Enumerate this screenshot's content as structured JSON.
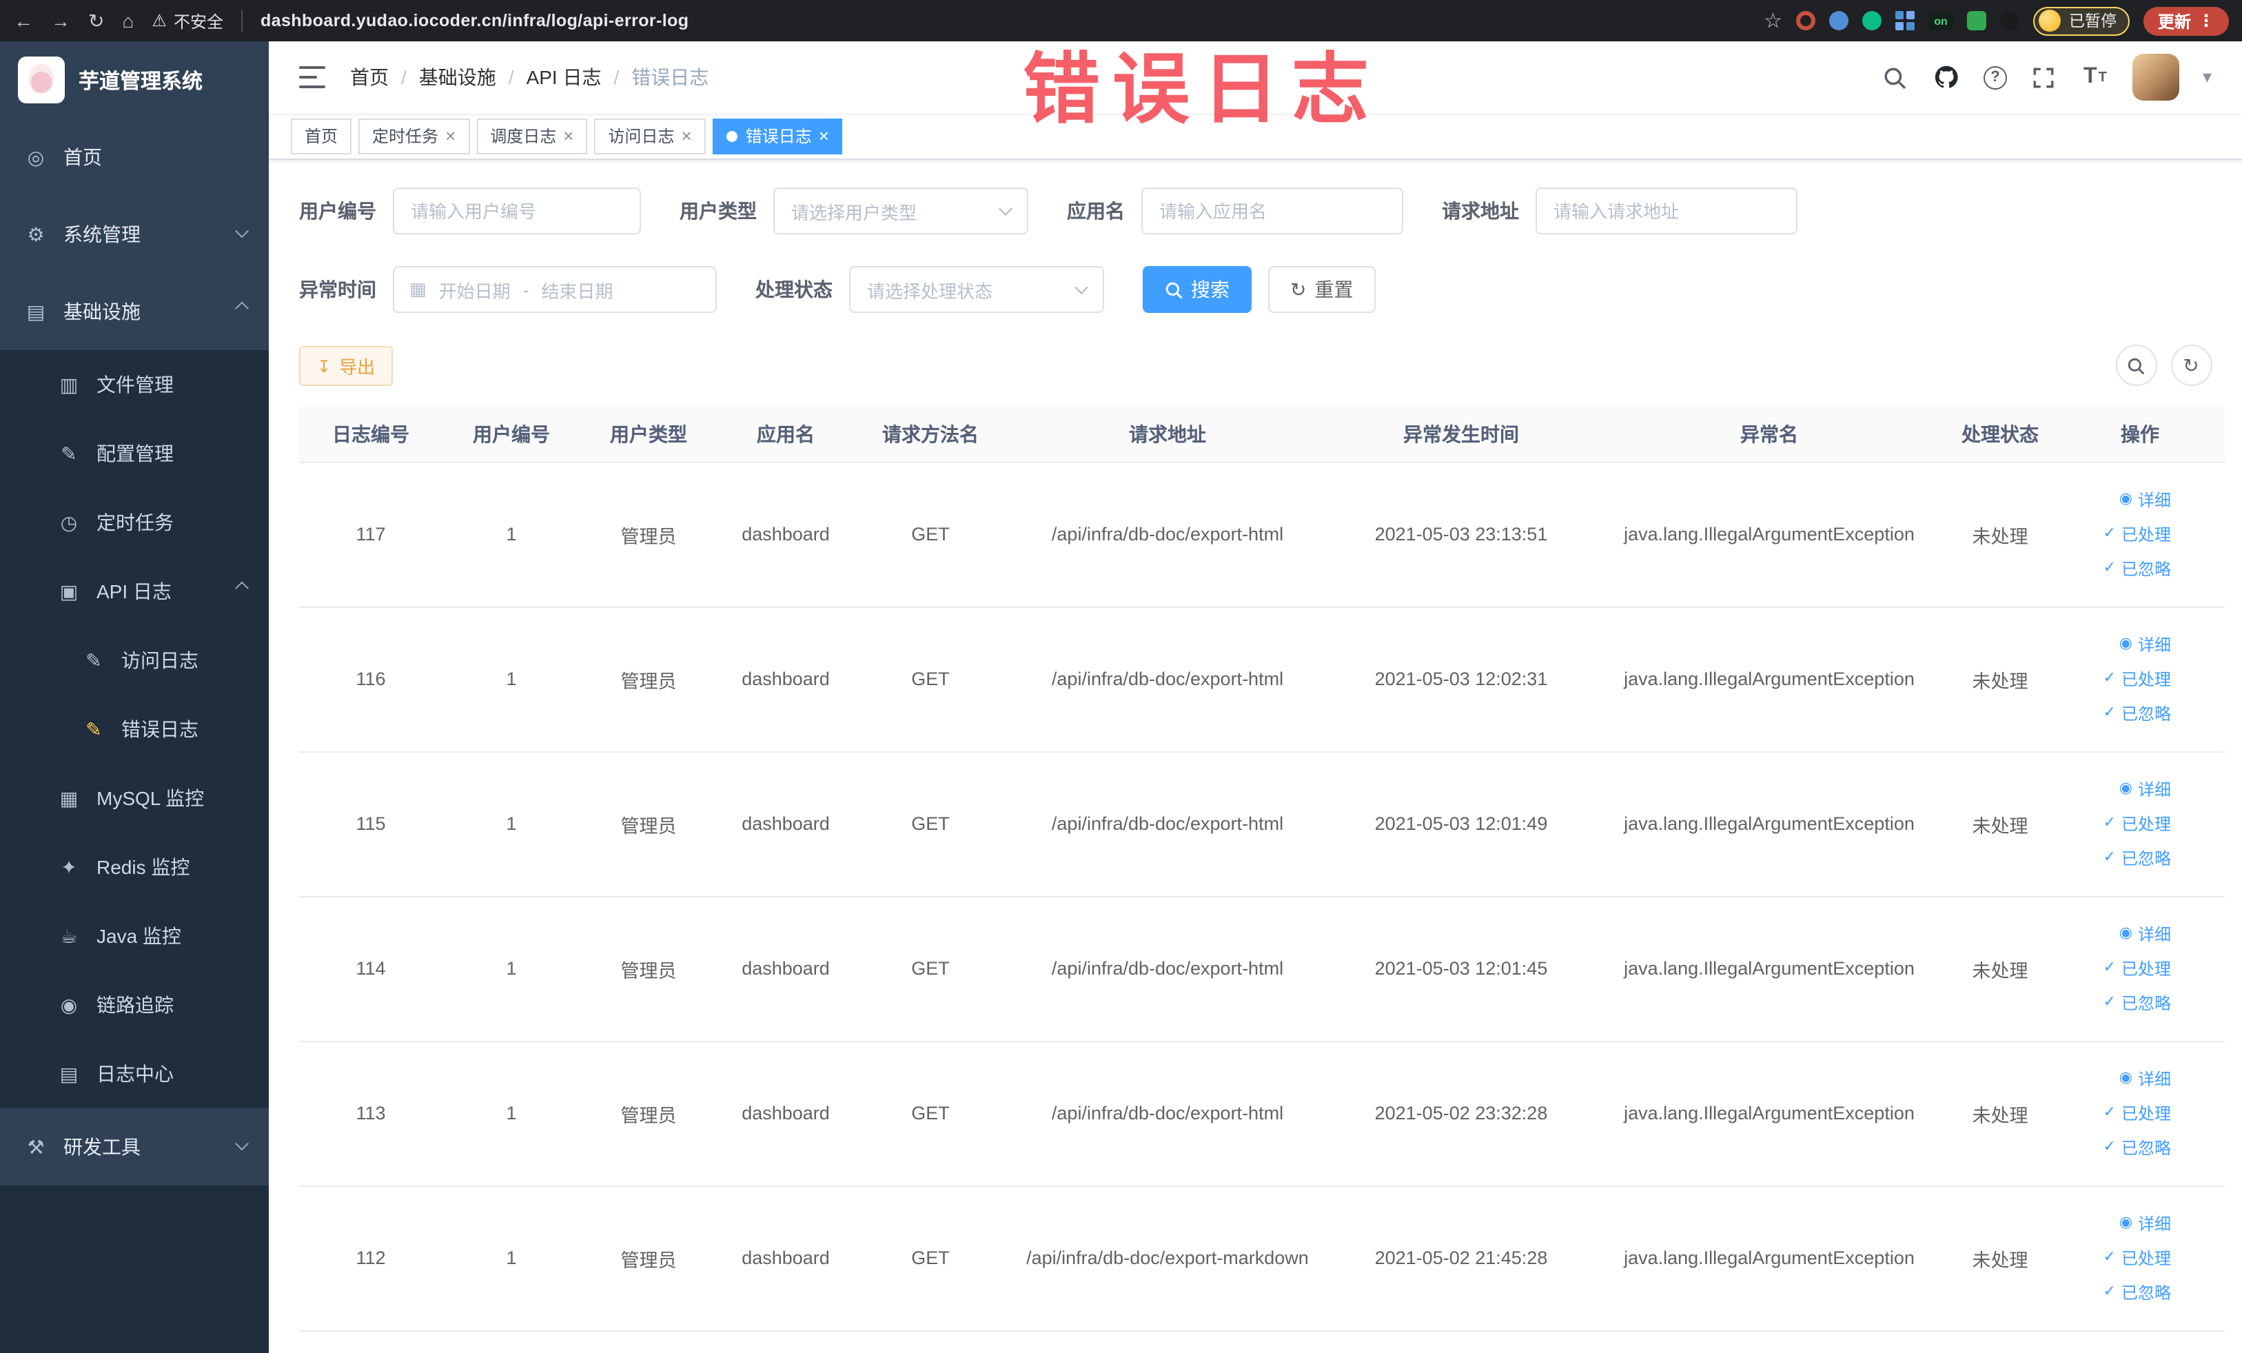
{
  "browser": {
    "security_label": "不安全",
    "url": "dashboard.yudao.iocoder.cn/infra/log/api-error-log",
    "profile_badge": "已暂停",
    "update_label": "更新"
  },
  "sidebar": {
    "logo_title": "芋道管理系统",
    "items": [
      "首页",
      "系统管理",
      "基础设施",
      "文件管理",
      "配置管理",
      "定时任务",
      "API 日志",
      "访问日志",
      "错误日志",
      "MySQL 监控",
      "Redis 监控",
      "Java 监控",
      "链路追踪",
      "日志中心",
      "研发工具"
    ]
  },
  "breadcrumb": [
    "首页",
    "基础设施",
    "API 日志",
    "错误日志"
  ],
  "watermark": "错误日志",
  "tabs": [
    {
      "label": "首页"
    },
    {
      "label": "定时任务"
    },
    {
      "label": "调度日志"
    },
    {
      "label": "访问日志"
    },
    {
      "label": "错误日志"
    }
  ],
  "filters": {
    "user_id_label": "用户编号",
    "user_id_placeholder": "请输入用户编号",
    "user_type_label": "用户类型",
    "user_type_placeholder": "请选择用户类型",
    "app_name_label": "应用名",
    "app_name_placeholder": "请输入应用名",
    "request_url_label": "请求地址",
    "request_url_placeholder": "请输入请求地址",
    "exception_time_label": "异常时间",
    "date_start_placeholder": "开始日期",
    "date_separator": "-",
    "date_end_placeholder": "结束日期",
    "process_status_label": "处理状态",
    "process_status_placeholder": "请选择处理状态",
    "search_label": "搜索",
    "reset_label": "重置"
  },
  "toolbar": {
    "export_label": "导出"
  },
  "table": {
    "columns": [
      "日志编号",
      "用户编号",
      "用户类型",
      "应用名",
      "请求方法名",
      "请求地址",
      "异常发生时间",
      "异常名",
      "处理状态",
      "操作"
    ],
    "actions": {
      "detail": "详细",
      "processed": "已处理",
      "ignored": "已忽略"
    },
    "rows": [
      {
        "id": "117",
        "user_id": "1",
        "user_type": "管理员",
        "app": "dashboard",
        "method": "GET",
        "url": "/api/infra/db-doc/export-html",
        "time": "2021-05-03 23:13:51",
        "exception": "java.lang.IllegalArgumentException",
        "status": "未处理"
      },
      {
        "id": "116",
        "user_id": "1",
        "user_type": "管理员",
        "app": "dashboard",
        "method": "GET",
        "url": "/api/infra/db-doc/export-html",
        "time": "2021-05-03 12:02:31",
        "exception": "java.lang.IllegalArgumentException",
        "status": "未处理"
      },
      {
        "id": "115",
        "user_id": "1",
        "user_type": "管理员",
        "app": "dashboard",
        "method": "GET",
        "url": "/api/infra/db-doc/export-html",
        "time": "2021-05-03 12:01:49",
        "exception": "java.lang.IllegalArgumentException",
        "status": "未处理"
      },
      {
        "id": "114",
        "user_id": "1",
        "user_type": "管理员",
        "app": "dashboard",
        "method": "GET",
        "url": "/api/infra/db-doc/export-html",
        "time": "2021-05-03 12:01:45",
        "exception": "java.lang.IllegalArgumentException",
        "status": "未处理"
      },
      {
        "id": "113",
        "user_id": "1",
        "user_type": "管理员",
        "app": "dashboard",
        "method": "GET",
        "url": "/api/infra/db-doc/export-html",
        "time": "2021-05-02 23:32:28",
        "exception": "java.lang.IllegalArgumentException",
        "status": "未处理"
      },
      {
        "id": "112",
        "user_id": "1",
        "user_type": "管理员",
        "app": "dashboard",
        "method": "GET",
        "url": "/api/infra/db-doc/export-markdown",
        "time": "2021-05-02 21:45:28",
        "exception": "java.lang.IllegalArgumentException",
        "status": "未处理"
      }
    ]
  }
}
